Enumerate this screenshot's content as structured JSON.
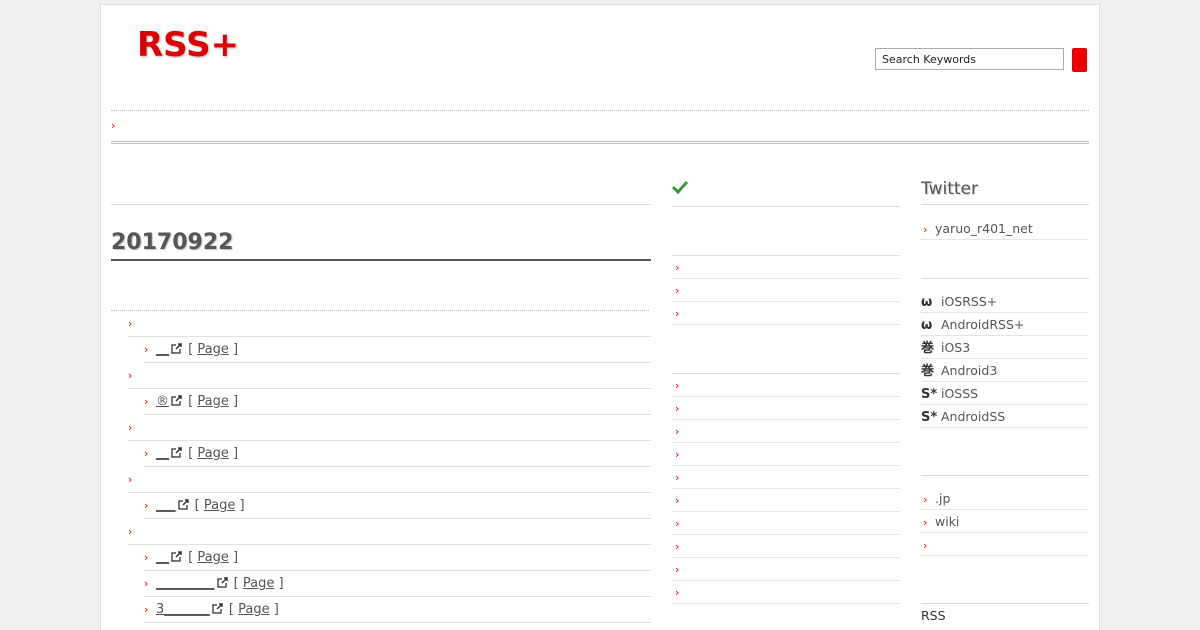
{
  "header": {
    "logo": "RSS+",
    "search_placeholder": "Search Keywords"
  },
  "main": {
    "title": "20170922",
    "groups": [
      {
        "items": [
          {
            "text": "__",
            "link": "Page"
          }
        ]
      },
      {
        "items": [
          {
            "text": "®",
            "link": "Page"
          }
        ]
      },
      {
        "items": [
          {
            "text": "__",
            "link": "Page"
          }
        ]
      },
      {
        "items": [
          {
            "text": "___",
            "link": "Page"
          }
        ]
      },
      {
        "items": [
          {
            "text": "__",
            "link": "Page"
          },
          {
            "text": "_________",
            "link": "Page"
          },
          {
            "text": "3_______",
            "link": "Page"
          }
        ]
      }
    ]
  },
  "sidebar": {
    "twitter_title": "Twitter",
    "twitter_user": "yaruo_r401_net",
    "apps": [
      {
        "icon": "ω",
        "label": "iOSRSS+"
      },
      {
        "icon": "ω",
        "label": "AndroidRSS+"
      },
      {
        "icon": "巻",
        "label": "iOS3"
      },
      {
        "icon": "巻",
        "label": "Android3"
      },
      {
        "icon": "S*",
        "label": "iOSSS"
      },
      {
        "icon": "S*",
        "label": "AndroidSS"
      }
    ],
    "links": [
      ".jp",
      "wiki",
      ""
    ],
    "rss_label": "RSS"
  },
  "colors": {
    "accent": "#dd0000",
    "check": "#3a9a3a"
  }
}
